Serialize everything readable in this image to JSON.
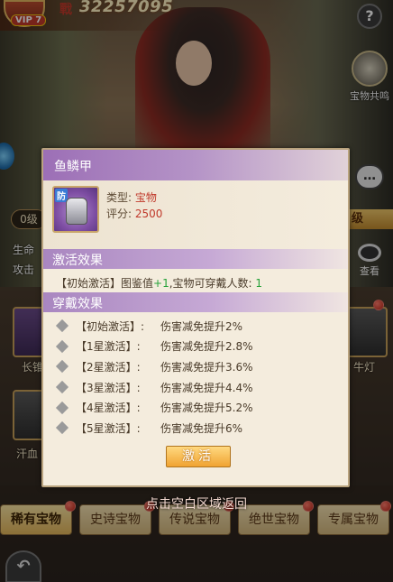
{
  "header": {
    "vip_label": "VIP 7",
    "power_icon_char": "戰",
    "power_value": "32257095",
    "help_label": "?"
  },
  "side": {
    "resonance_label": "宝物共鸣",
    "chat_label": "…",
    "level_left": "0级",
    "level_right": "级",
    "stat_hp": "生命",
    "stat_atk": "攻击",
    "view_label": "查看"
  },
  "background_cards": [
    {
      "label": "长锥"
    },
    {
      "label": "汗血"
    },
    {
      "label": "牛灯"
    }
  ],
  "tabs": [
    {
      "label": "稀有宝物"
    },
    {
      "label": "史诗宝物"
    },
    {
      "label": "传说宝物"
    },
    {
      "label": "绝世宝物"
    },
    {
      "label": "专属宝物"
    }
  ],
  "hint": "点击空白区域返回",
  "popup": {
    "title": "鱼鳞甲",
    "item": {
      "icon_tag": "防",
      "type_label": "类型: ",
      "type_value": "宝物",
      "score_label": "评分: ",
      "score_value": "2500"
    },
    "activation_section": {
      "title": "激活效果",
      "line_prefix": "【初始激活】图鉴值",
      "line_plus": "+1",
      "line_mid": ",宝物可穿戴人数: ",
      "line_count": "1"
    },
    "wear_section": {
      "title": "穿戴效果",
      "effects": [
        {
          "name": "【初始激活】:",
          "desc": "伤害减免提升2%"
        },
        {
          "name": "【1星激活】:",
          "desc": "伤害减免提升2.8%"
        },
        {
          "name": "【2星激活】:",
          "desc": "伤害减免提升3.6%"
        },
        {
          "name": "【3星激活】:",
          "desc": "伤害减免提升4.4%"
        },
        {
          "name": "【4星激活】:",
          "desc": "伤害减免提升5.2%"
        },
        {
          "name": "【5星激活】:",
          "desc": "伤害减免提升6%"
        }
      ]
    },
    "activate_button": "激活"
  }
}
